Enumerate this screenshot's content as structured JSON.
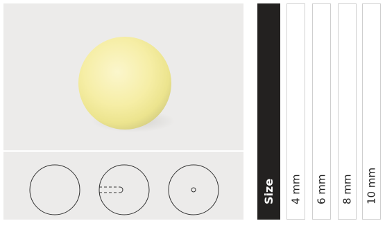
{
  "product": {
    "color_name": "pastel-yellow-pearl",
    "pearl_color": "#f7efa8",
    "background": "#ecebea",
    "drawings": [
      "front-view",
      "side-view-drilled",
      "top-view-hole"
    ]
  },
  "sizes": {
    "header": "Size",
    "values": [
      "4 mm",
      "6 mm",
      "8 mm",
      "10 mm"
    ]
  }
}
